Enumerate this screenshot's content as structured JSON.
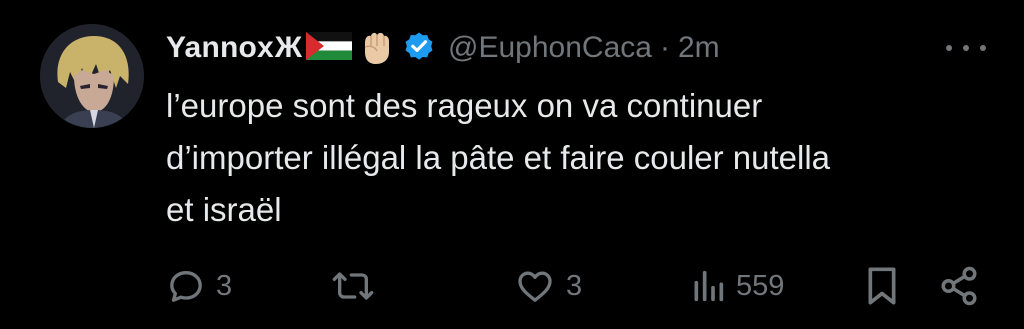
{
  "tweet": {
    "display_name": "Yannox",
    "name_symbol": "Ж",
    "handle": "@EuphonCaca",
    "separator": "·",
    "time": "2m",
    "text_lines": [
      "l’europe sont des rageux on va continuer",
      "d’importer illégal la pâte et faire couler nutella",
      "et israël"
    ]
  },
  "actions": {
    "reply_count": "3",
    "retweet_count": "",
    "like_count": "3",
    "views_count": "559"
  },
  "icons": {
    "flag": "palestine-flag-icon",
    "fist": "raised-fist-icon",
    "verified": "verified-badge-icon",
    "more": "more-icon",
    "reply": "reply-icon",
    "retweet": "retweet-icon",
    "like": "heart-icon",
    "views": "views-icon",
    "bookmark": "bookmark-icon",
    "share": "share-icon"
  },
  "colors": {
    "background": "#000000",
    "text": "#e7e9ea",
    "secondary": "#71767b",
    "verified": "#1d9bf0"
  }
}
